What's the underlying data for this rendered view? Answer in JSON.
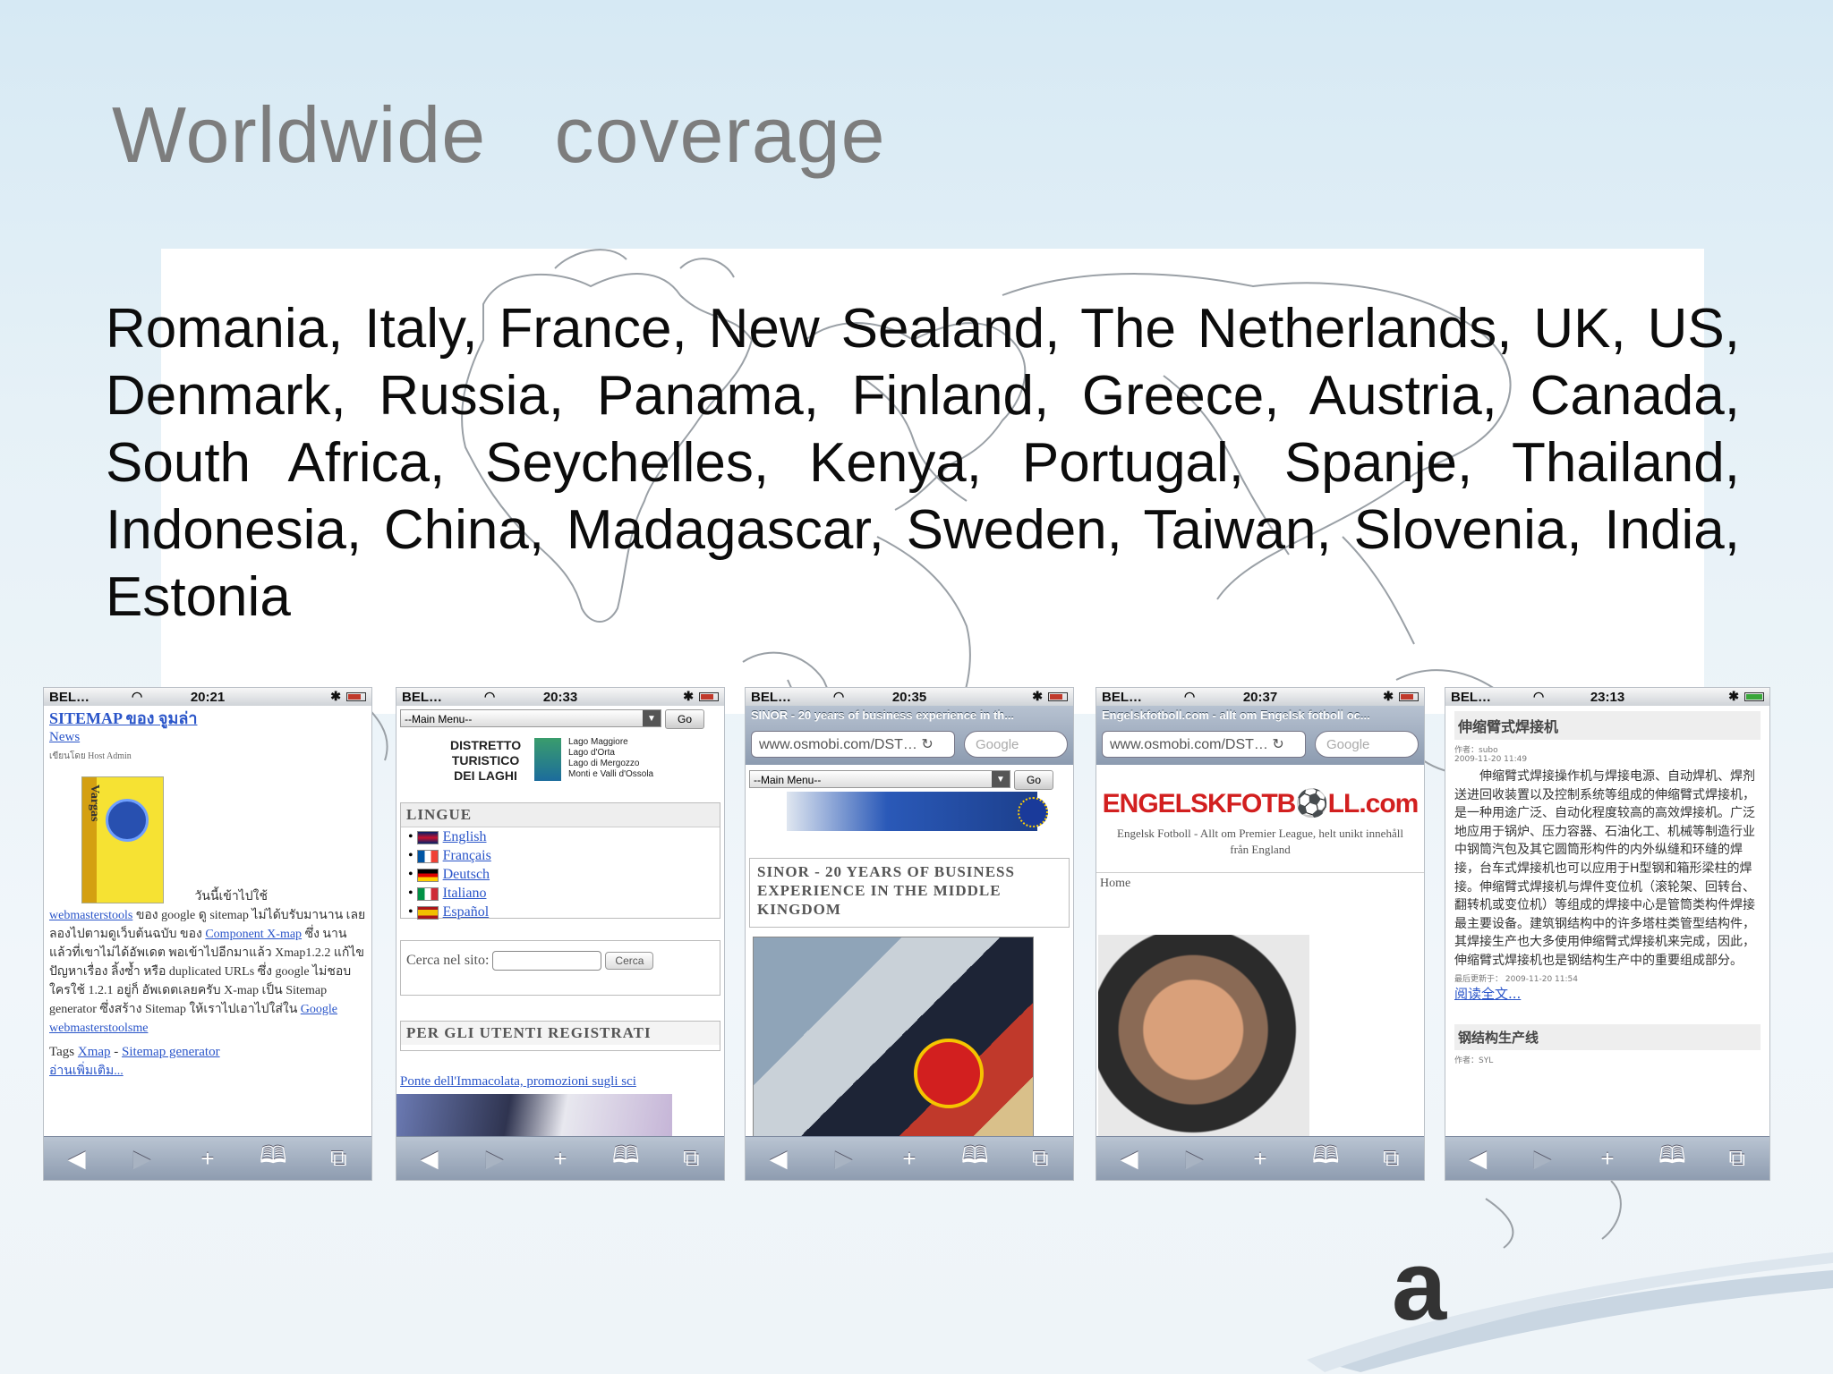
{
  "slide": {
    "title": "Worldwide   coverage",
    "countries": "Romania, Italy, France, New Sealand, The Netherlands, UK, US, Denmark, Russia, Panama, Finland, Greece, Austria, Canada, South Africa, Seychelles, Kenya, Portugal, Spanje, Thailand, Indonesia, China, Madagascar, Sweden, Taiwan, Slovenia, India, Estonia",
    "logo_fragment": "a"
  },
  "colors": {
    "title": "#7d7d7d",
    "text": "#0c0c0c",
    "link": "#2a55c9",
    "logo_accent": "#e55a1c"
  },
  "toolbar_icons": [
    "back-arrow-icon",
    "forward-arrow-icon",
    "plus-icon",
    "bookmarks-icon",
    "pages-icon"
  ],
  "toolbar_glyphs": {
    "back": "◀",
    "forward": "▶",
    "add": "+",
    "bookmarks": "🕮",
    "pages": "⧉"
  },
  "phones": [
    {
      "carrier": "BEL…",
      "time": "20:21",
      "sitemap_title": "SITEMAP ของ จูมล่า",
      "news": "News",
      "meta": "เขียนโดย Host Admin",
      "product_label": "Vargas",
      "caption": "วันนี้เข้าไปใช้",
      "body": [
        {
          "link": "webmasterstools",
          "text": " ของ google ดู sitemap ไม่ได้บรับมานาน เลยลองไปตามดูเว็บต้นฉบับ ของ "
        },
        {
          "link": "Component X-map",
          "text": " ซึ่ง นานแล้วที่เขาไม่ได้อัพเดต พอเข้าไปอีกมาแล้ว Xmap1.2.2 แก้ไขปัญหาเรื่อง ลิ้งซ้ำ หรือ duplicated URLs ซึ่ง google ไม่ชอบ ใครใช้ 1.2.1 อยู่ก็ อัพเดตเลยครับ X-map เป็น Sitemap generator ซึ่งสร้าง Sitemap ให้เราไปเอาไปใส่ใน "
        },
        {
          "link": "Google webmasterstoolsme",
          "text": ""
        }
      ],
      "tags_label": "Tags ",
      "tag1": "Xmap",
      "tag_sep": " - ",
      "tag2": "Sitemap generator",
      "read_more": "อ่านเพิ่มเติม..."
    },
    {
      "carrier": "BEL…",
      "time": "20:33",
      "menu": "--Main Menu--",
      "go": "Go",
      "district": [
        "DISTRETTO",
        "TURISTICO",
        "DEI LAGHI"
      ],
      "lakes": [
        "Lago Maggiore",
        "Lago d'Orta",
        "Lago di Mergozzo",
        "Monti e Valli d'Ossola"
      ],
      "lingue": "LINGUE",
      "languages": [
        "English",
        "Français",
        "Deutsch",
        "Italiano",
        "Español"
      ],
      "search_label": "Cerca nel sito:",
      "search_btn": "Cerca",
      "registered": "PER GLI UTENTI REGISTRATI",
      "promo": "Ponte dell'Immacolata, promozioni sugli sci"
    },
    {
      "carrier": "BEL…",
      "time": "20:35",
      "page_title": "SINOR - 20 years of business experience in th...",
      "url": "www.osmobi.com/DST…",
      "search": "Google",
      "menu": "--Main Menu--",
      "go": "Go",
      "heading": "SINOR - 20 YEARS OF BUSINESS EXPERIENCE IN THE MIDDLE KINGDOM"
    },
    {
      "carrier": "BEL…",
      "time": "20:37",
      "page_title": "Engelskfotboll.com - allt om Engelsk fotboll oc...",
      "url": "www.osmobi.com/DST…",
      "search": "Google",
      "logo": "ENGELSKFOTB⚽LL.com",
      "tagline": "Engelsk Fotboll - Allt om Premier League, helt unikt innehåll från England",
      "nav": "Home"
    },
    {
      "carrier": "BEL…",
      "time": "23:13",
      "article_title": "伸缩臂式焊接机",
      "author": "作者：subo",
      "date": "2009-11-20 11:49",
      "body": "伸缩臂式焊接操作机与焊接电源、自动焊机、焊剂送进回收装置以及控制系统等组成的伸缩臂式焊接机，是一种用途广泛、自动化程度较高的高效焊接机。广泛地应用于锅炉、压力容器、石油化工、机械等制造行业中钢筒汽包及其它圆筒形构件的内外纵缝和环缝的焊接，台车式焊接机也可以应用于H型钢和箱形梁柱的焊接。伸缩臂式焊接机与焊件变位机（滚轮架、回转台、翻转机或变位机）等组成的焊接中心是管筒类构件焊接最主要设备。建筑钢结构中的许多塔柱类管型结构件，其焊接生产也大多使用伸缩臂式焊接机来完成，因此，伸缩臂式焊接机也是钢结构生产中的重要组成部分。",
      "updated": "最后更新于： 2009-11-20 11:54",
      "read_more": "阅读全文...",
      "next_title": "钢结构生产线",
      "next_author": "作者：SYL"
    }
  ]
}
